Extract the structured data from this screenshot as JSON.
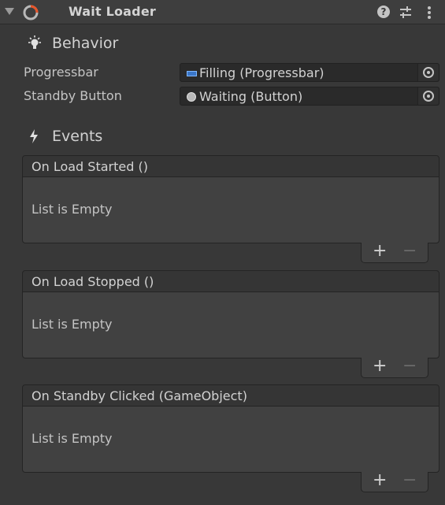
{
  "component": {
    "title": "Wait Loader",
    "help_label": "?"
  },
  "behavior": {
    "heading": "Behavior",
    "fields": [
      {
        "label": "Progressbar",
        "value": "Filling (Progressbar)"
      },
      {
        "label": "Standby Button",
        "value": "Waiting (Button)"
      }
    ]
  },
  "events": {
    "heading": "Events",
    "items": [
      {
        "title": "On Load Started ()",
        "empty_text": "List is Empty"
      },
      {
        "title": "On Load Stopped ()",
        "empty_text": "List is Empty"
      },
      {
        "title": "On Standby Clicked (GameObject)",
        "empty_text": "List is Empty"
      }
    ],
    "add_label": "+",
    "remove_label": "−"
  },
  "icons": {
    "foldout": "chevron-down-icon",
    "component": "loader-ring-icon",
    "help": "help-icon",
    "presets": "sliders-icon",
    "more": "kebab-menu-icon",
    "behavior": "lightbulb-icon",
    "events": "lightning-icon",
    "object_picker": "object-picker-icon"
  },
  "colors": {
    "accent_orange": "#e8552a",
    "progress_icon_blue": "#3a76c8"
  }
}
